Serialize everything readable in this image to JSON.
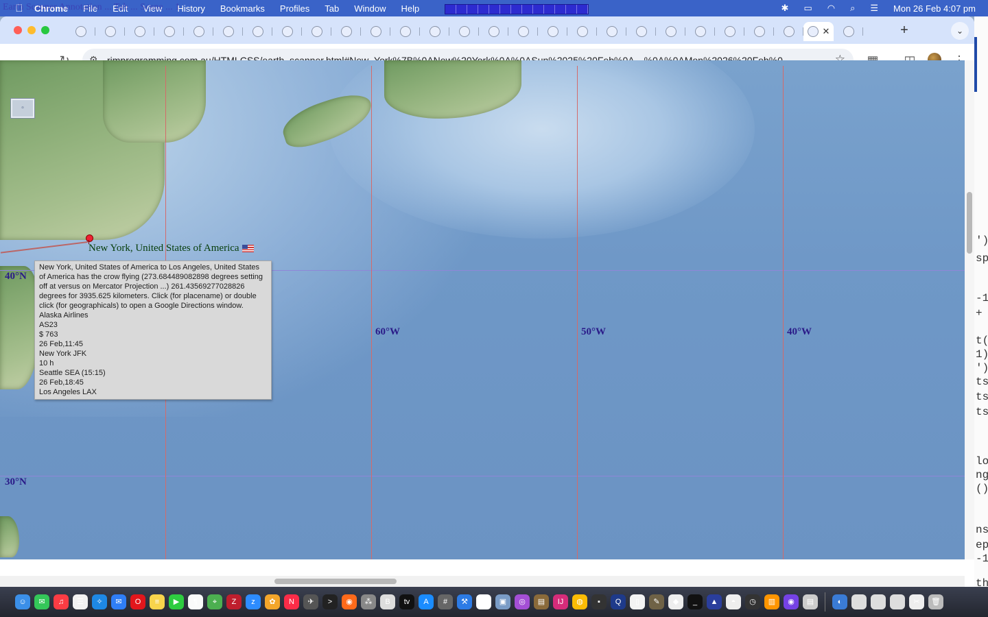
{
  "menubar": {
    "overlay_title": "Earth Scanner Annotation ... Tab ... Scene ... 1",
    "items": [
      "Chrome",
      "File",
      "Edit",
      "View",
      "History",
      "Bookmarks",
      "Profiles",
      "Tab",
      "Window",
      "Help"
    ],
    "datetime": "Mon 26 Feb  4:07 pm",
    "icons": [
      "bluetooth-icon",
      "battery-icon",
      "wifi-icon",
      "spotlight-search-icon",
      "control-center-icon"
    ]
  },
  "browser": {
    "url": "rjmprogramming.com.au/HTMLCSS/earth_scanner.html#New_York%7B%0ANew%20York%0A%0ASun%2025%20Feb%0A—%0A%0AMon%2026%20Feb%0...",
    "tab_count": 27,
    "colors": {
      "tabstrip": "#d6e3fb",
      "close": "#ff5f57",
      "minimize": "#febc2e",
      "zoom": "#28c840"
    }
  },
  "map": {
    "place_label": "New York, United States of America",
    "latitudes": [
      {
        "label": "40°N"
      },
      {
        "label": "30°N"
      }
    ],
    "longitudes": [
      {
        "label": "60°W"
      },
      {
        "label": "50°W"
      },
      {
        "label": "40°W"
      }
    ],
    "minimize_button_glyph": "▫"
  },
  "tooltip": {
    "lines": [
      "New York, United States of America to Los Angeles, United States of America has the crow flying (273.684489082898 degrees setting off at versus on Mercator Projection ...) 261.43569277028826 degrees for 3935.625 kilometers.  Click (for placename) or double click (for geographicals) to open a Google Directions window.",
      "Alaska Airlines",
      "AS23",
      "$ 763",
      "26 Feb,11:45",
      "New York JFK",
      "10 h",
      "Seattle SEA (15:15)",
      "26 Feb,18:45",
      "Los Angeles LAX"
    ]
  },
  "editor_peek": {
    "lines": [
      "')",
      "sp",
      "-1",
      "+",
      "t(",
      "1)",
      "')",
      "ts",
      "ts",
      "ts",
      "lo",
      "ng",
      "()",
      "ns",
      "ep",
      "-1",
      "th"
    ]
  },
  "dock": {
    "apps": [
      {
        "name": "finder-icon",
        "color": "#3b8fe8",
        "glyph": "☺"
      },
      {
        "name": "messages-icon",
        "color": "#34c759",
        "glyph": "✉"
      },
      {
        "name": "music-icon",
        "color": "#fc3c44",
        "glyph": "♫"
      },
      {
        "name": "reminders-icon",
        "color": "#f2f2f2",
        "glyph": "☰"
      },
      {
        "name": "safari-icon",
        "color": "#1e88e5",
        "glyph": "✧"
      },
      {
        "name": "mail-icon",
        "color": "#2f7ef7",
        "glyph": "✉"
      },
      {
        "name": "opera-icon",
        "color": "#e2161c",
        "glyph": "O"
      },
      {
        "name": "notes-icon",
        "color": "#f8d44c",
        "glyph": "≡"
      },
      {
        "name": "facetime-icon",
        "color": "#2ecc40",
        "glyph": "▶"
      },
      {
        "name": "textedit-icon",
        "color": "#fafafa",
        "glyph": "¶"
      },
      {
        "name": "maps-icon",
        "color": "#4caf50",
        "glyph": "⌖"
      },
      {
        "name": "filezilla-icon",
        "color": "#bf1e2d",
        "glyph": "Z"
      },
      {
        "name": "zoom-icon",
        "color": "#2d8cff",
        "glyph": "z"
      },
      {
        "name": "photos-icon",
        "color": "#f4a62a",
        "glyph": "✿"
      },
      {
        "name": "news-icon",
        "color": "#fb2c48",
        "glyph": "N"
      },
      {
        "name": "utility-icon",
        "color": "#555",
        "glyph": "✈"
      },
      {
        "name": "terminal-icon",
        "color": "#222",
        "glyph": ">"
      },
      {
        "name": "firefox-icon",
        "color": "#ff6a1a",
        "glyph": "◉"
      },
      {
        "name": "launchpad-icon",
        "color": "#888",
        "glyph": "⁂"
      },
      {
        "name": "bbedit-icon",
        "color": "#ddd",
        "glyph": "B"
      },
      {
        "name": "appletv-icon",
        "color": "#111",
        "glyph": "tv"
      },
      {
        "name": "appstore-icon",
        "color": "#1a8cff",
        "glyph": "A"
      },
      {
        "name": "calculator-icon",
        "color": "#666",
        "glyph": "#"
      },
      {
        "name": "xcode-icon",
        "color": "#2c7be5",
        "glyph": "⚒"
      },
      {
        "name": "calendar-icon",
        "color": "#fff",
        "glyph": "26"
      },
      {
        "name": "preview-icon",
        "color": "#7a9cc6",
        "glyph": "▣"
      },
      {
        "name": "podcasts-icon",
        "color": "#a44fd6",
        "glyph": "◎"
      },
      {
        "name": "archive-icon",
        "color": "#8a6a3a",
        "glyph": "▤"
      },
      {
        "name": "intellij-icon",
        "color": "#d62c7a",
        "glyph": "IJ"
      },
      {
        "name": "chrome-icon",
        "color": "#fbbc05",
        "glyph": "◍"
      },
      {
        "name": "console-icon",
        "color": "#333",
        "glyph": "▪"
      },
      {
        "name": "quicktime-icon",
        "color": "#1e3a8a",
        "glyph": "Q"
      },
      {
        "name": "document-icon",
        "color": "#f3f3f3",
        "glyph": "▯"
      },
      {
        "name": "gimp-icon",
        "color": "#6f6246",
        "glyph": "✎"
      },
      {
        "name": "inkscape-icon",
        "color": "#eee",
        "glyph": "◆"
      },
      {
        "name": "terminal2-icon",
        "color": "#111",
        "glyph": "_"
      },
      {
        "name": "affinity-icon",
        "color": "#2a3e9c",
        "glyph": "▲"
      },
      {
        "name": "github-icon",
        "color": "#eee",
        "glyph": "◓"
      },
      {
        "name": "activity-icon",
        "color": "#333",
        "glyph": "◷"
      },
      {
        "name": "books-icon",
        "color": "#ff9500",
        "glyph": "▥"
      },
      {
        "name": "firefox-dev-icon",
        "color": "#7542e5",
        "glyph": "◉"
      },
      {
        "name": "files-icon",
        "color": "#ccc",
        "glyph": "▤"
      },
      {
        "name": "globe-icon",
        "color": "#3a7bd5",
        "glyph": "◐"
      },
      {
        "name": "window1-icon",
        "color": "#ddd",
        "glyph": ""
      },
      {
        "name": "window2-icon",
        "color": "#ddd",
        "glyph": ""
      },
      {
        "name": "window3-icon",
        "color": "#ddd",
        "glyph": ""
      },
      {
        "name": "screenshot-icon",
        "color": "#eee",
        "glyph": "✂"
      },
      {
        "name": "trash-icon",
        "color": "#bbb",
        "glyph": "🗑"
      }
    ]
  }
}
